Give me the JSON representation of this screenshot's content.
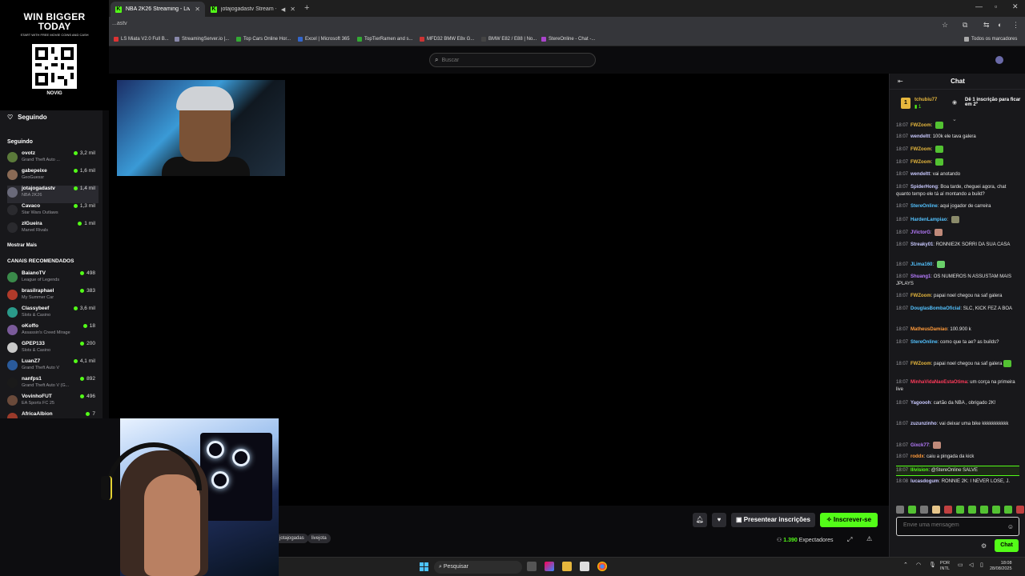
{
  "browser": {
    "tabs": [
      {
        "label": "NBA 2K26 Streaming - Live Stre",
        "active": true
      },
      {
        "label": "jotajogadastv Stream - Wa",
        "active": false
      }
    ],
    "address": "...astv",
    "bookmarks": [
      "LS Miata V2.0 Full B...",
      "StreamingServer.io |...",
      "Top Cars Online Hor...",
      "Excel | Microsoft 365",
      "TopTierRamen and s...",
      "MFD32 BMW E8x G...",
      "BMW E82 / E88 | No...",
      "StereOnline - Chat -..."
    ],
    "all_bookmarks": "Todos os marcadores"
  },
  "ad": {
    "line1": "WIN BIGGER",
    "line2": "TODAY",
    "line3": "START WITH FREE MOVIE COINS AND CASH",
    "brand": "NOVIG"
  },
  "header": {
    "search_placeholder": "Buscar"
  },
  "sidebar": {
    "following_title": "Seguindo",
    "following_section": "Seguindo",
    "following": [
      {
        "name": "ovotz",
        "game": "Grand Theft Auto ...",
        "viewers": "3,2 mil",
        "color": "#5b7a3a"
      },
      {
        "name": "gabepeixe",
        "game": "GeoGuessr",
        "viewers": "1,6 mil",
        "color": "#8a6a55"
      },
      {
        "name": "jotajogadastv",
        "game": "NBA 2K26",
        "viewers": "1,4 mil",
        "color": "#6a6a7a"
      },
      {
        "name": "Cavaco",
        "game": "Star Wars Outlaws",
        "viewers": "1,3 mil",
        "color": "#2a2a2e"
      },
      {
        "name": "zIGueira",
        "game": "Marvel Rivals",
        "viewers": "1 mil",
        "color": "#2a2a2e"
      }
    ],
    "show_more": "Mostrar Mais",
    "recommended_title": "CANAIS RECOMENDADOS",
    "recommended": [
      {
        "name": "BaianoTV",
        "game": "League of Legends",
        "viewers": "498",
        "color": "#3a8a4a"
      },
      {
        "name": "brasilraphael",
        "game": "My Summer Car",
        "viewers": "383",
        "color": "#b03a2a"
      },
      {
        "name": "Classybeef",
        "game": "Slots & Casino",
        "viewers": "3,6 mil",
        "color": "#2a9a8a"
      },
      {
        "name": "oKoffo",
        "game": "Assassin's Creed Mirage",
        "viewers": "18",
        "color": "#7a5a9a"
      },
      {
        "name": "GPEP133",
        "game": "Slots & Casino",
        "viewers": "200",
        "color": "#c9c9c9"
      },
      {
        "name": "LuanZ7",
        "game": "Grand Theft Auto V",
        "viewers": "4,1 mil",
        "color": "#2a5a9a"
      },
      {
        "name": "nanfps1",
        "game": "Grand Theft Auto V (G...",
        "viewers": "892",
        "color": "#1a1a1a"
      },
      {
        "name": "VovinhoFUT",
        "game": "EA Sports FC 25",
        "viewers": "496",
        "color": "#6a4a3a"
      },
      {
        "name": "AfricaAlbion",
        "game": "",
        "viewers": "7",
        "color": "#9a3a2a"
      }
    ]
  },
  "stream": {
    "tags": [
      "jotajogadas",
      "livejota"
    ],
    "gift_label": "Presentear inscrições",
    "subscribe_label": "Inscrever-se",
    "viewers_count": "1.390",
    "viewers_label": "Expectadores"
  },
  "chat": {
    "title": "Chat",
    "pinned": {
      "user": "tchubiu77",
      "subs": "1",
      "message": "Dê 1 inscrição para ficar em 2º"
    },
    "messages": [
      {
        "time": "18:07",
        "user": "FWZoom",
        "text": "",
        "color": "#e6b73d",
        "emote": "#53c232"
      },
      {
        "time": "18:07",
        "user": "wendeltt",
        "text": "100k ele tava galera",
        "color": "#c9c9ff"
      },
      {
        "time": "18:07",
        "user": "FWZoom",
        "text": "",
        "color": "#e6b73d",
        "emote": "#53c232"
      },
      {
        "time": "18:07",
        "user": "FWZoom",
        "text": "",
        "color": "#e6b73d",
        "emote": "#53c232"
      },
      {
        "time": "18:07",
        "user": "wendeltt",
        "text": "vai anotando",
        "color": "#c9c9ff"
      },
      {
        "time": "18:07",
        "user": "SpiderHong",
        "text": "Boa tarde, cheguei agora, chat quanto tempo ele tá aí montando a build?",
        "color": "#c9c9ff"
      },
      {
        "time": "18:07",
        "user": "StereOnline",
        "text": "aqui jogador de carreira",
        "color": "#53c2ff"
      },
      {
        "time": "18:07",
        "user": "HardenLampiao",
        "text": "",
        "color": "#53c2ff",
        "emote": "#8a8a6a"
      },
      {
        "time": "18:07",
        "user": "JVictorG",
        "text": "",
        "color": "#b77cff",
        "emote": "#c08a7a"
      },
      {
        "time": "18:07",
        "user": "Streaky01",
        "text": "RONNIE2K SORRI DA SUA CASA",
        "color": "#c9c9ff"
      },
      {
        "time": "18:07",
        "user": "JLima160",
        "text": "",
        "color": "#53c2ff",
        "emote": "#6ad06a"
      },
      {
        "time": "18:07",
        "user": "Shuang1",
        "text": "OS NUMEROS N ASSUSTAM MAIS JPLAYS",
        "color": "#b77cff"
      },
      {
        "time": "18:07",
        "user": "FWZoom",
        "text": "papai noel chegou na saf galera",
        "color": "#e6b73d"
      },
      {
        "time": "18:07",
        "user": "DouglasBombaOficial",
        "text": "SLC, KICK FEZ A BOA",
        "color": "#53c2ff"
      },
      {
        "time": "18:07",
        "user": "MatheusDamiao",
        "text": "100.900 k",
        "color": "#ff9a3a"
      },
      {
        "time": "18:07",
        "user": "StereOnline",
        "text": "como que ta ae? as builds?",
        "color": "#53c2ff"
      },
      {
        "time": "18:07",
        "user": "FWZoom",
        "text": "papai noel chegou na saf galera",
        "color": "#e6b73d",
        "emote": "#53c232"
      },
      {
        "time": "18:07",
        "user": "MinhaVidaNaoEstaOtima",
        "text": "um corça na primeira live",
        "color": "#ff3a5a"
      },
      {
        "time": "18:07",
        "user": "Yagoooh",
        "text": "cartão da NBA , obrigado 2K!",
        "color": "#c9c9ff"
      },
      {
        "time": "18:07",
        "user": "zuzunzinho",
        "text": "vai deixar uma bike kkkkkkkkkkk",
        "color": "#c9c9ff"
      },
      {
        "time": "18:07",
        "user": "Gixck77",
        "text": "",
        "color": "#b77cff",
        "emote": "#c08a7a"
      },
      {
        "time": "18:07",
        "user": "roddx",
        "text": "caiu a pingada da kick",
        "color": "#ff9a3a"
      },
      {
        "time": "18:07",
        "user": "Ilivision",
        "text": "@StereOnline SALVE",
        "color": "#53fc18"
      },
      {
        "time": "18:08",
        "user": "lucasdogum",
        "text": "RONNIE 2K: I NEVER LOSE, J.",
        "color": "#c9c9ff"
      }
    ],
    "input_placeholder": "Envie uma mensagem",
    "send_label": "Chat"
  },
  "taskbar": {
    "search_label": "Pesquisar",
    "lang1": "POR",
    "lang2": "INTL",
    "time": "18:08",
    "date": "28/08/2025"
  }
}
